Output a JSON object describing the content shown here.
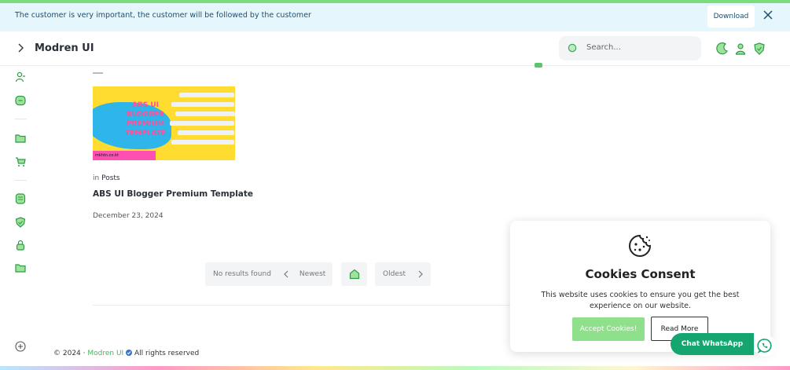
{
  "notice": {
    "text": "The customer is very important, the customer will be followed by the customer",
    "download_label": "Download",
    "close_icon": "close-icon"
  },
  "header": {
    "brand": "Modren UI",
    "search_placeholder": "Search...",
    "icons": [
      "moon-icon",
      "user-icon",
      "shield-icon"
    ]
  },
  "sidebar": {
    "icons": [
      "users-icon",
      "message-icon",
      "folder-icon",
      "cart-icon",
      "file-icon",
      "shield-icon",
      "lock-icon",
      "folder-icon",
      "plus-circle-icon"
    ]
  },
  "post": {
    "thumb_text": "ABS UI BLOGGER PREMIUM TEMPLATE",
    "thumb_footer": "mkhtn.co.kt",
    "category_prefix": "in",
    "category": "Posts",
    "title": "ABS UI Blogger Premium Template",
    "date": "December 23, 2024"
  },
  "pagination": {
    "no_results": "No results found",
    "newest": "Newest",
    "oldest": "Oldest"
  },
  "footer": {
    "copyright": "© 2024 ·",
    "brand": "Modren UI",
    "rights": "All rights reserved"
  },
  "cookie": {
    "title": "Cookies Consent",
    "description": "This website uses cookies to ensure you get the best experience on our website.",
    "accept_label": "Accept Cookies!",
    "read_more_label": "Read More"
  },
  "whatsapp": {
    "label": "Chat WhatsApp"
  },
  "colors": {
    "accent": "#7bdc7b",
    "notice_bg": "#e6f6fd",
    "whatsapp": "#14a66e"
  }
}
